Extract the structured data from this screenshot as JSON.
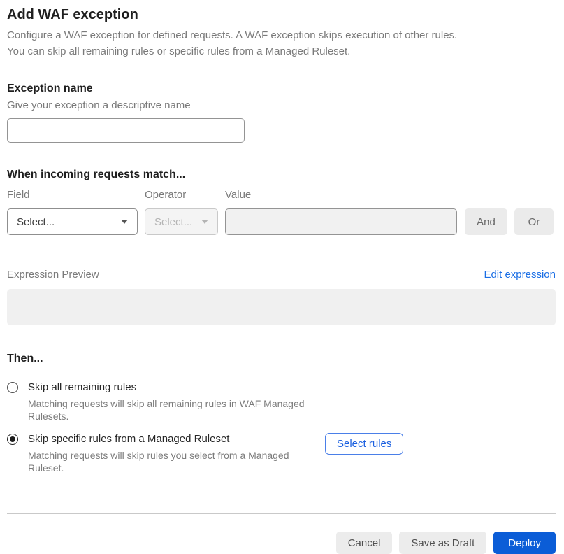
{
  "page": {
    "title": "Add WAF exception",
    "description_line1": "Configure a WAF exception for defined requests. A WAF exception skips execution of other rules.",
    "description_line2": "You can skip all remaining rules or specific rules from a Managed Ruleset."
  },
  "exception_name": {
    "heading": "Exception name",
    "subheading": "Give your exception a descriptive name",
    "value": ""
  },
  "match_builder": {
    "heading": "When incoming requests match...",
    "field": {
      "label": "Field",
      "selected": "Select...",
      "disabled": false
    },
    "operator": {
      "label": "Operator",
      "selected": "Select...",
      "disabled": true
    },
    "value": {
      "label": "Value",
      "value": "",
      "disabled": true
    },
    "and_label": "And",
    "or_label": "Or"
  },
  "expression_preview": {
    "label": "Expression Preview",
    "edit_link": "Edit expression",
    "content": ""
  },
  "then_section": {
    "heading": "Then...",
    "options": [
      {
        "label": "Skip all remaining rules",
        "description": "Matching requests will skip all remaining rules in WAF Managed Rulesets.",
        "selected": false
      },
      {
        "label": "Skip specific rules from a Managed Ruleset",
        "description": "Matching requests will skip rules you select from a Managed Ruleset.",
        "selected": true
      }
    ],
    "select_rules_label": "Select rules"
  },
  "footer": {
    "cancel_label": "Cancel",
    "save_draft_label": "Save as Draft",
    "deploy_label": "Deploy"
  },
  "colors": {
    "accent_link_blue": "#1a6ee5",
    "deploy_button_blue": "#0b5dd7",
    "disabled_field_bg": "#f1f1f1",
    "neutral_button_bg": "#ececec",
    "text_dark": "#1f1f1f",
    "text_gray": "#7a7a7a"
  }
}
